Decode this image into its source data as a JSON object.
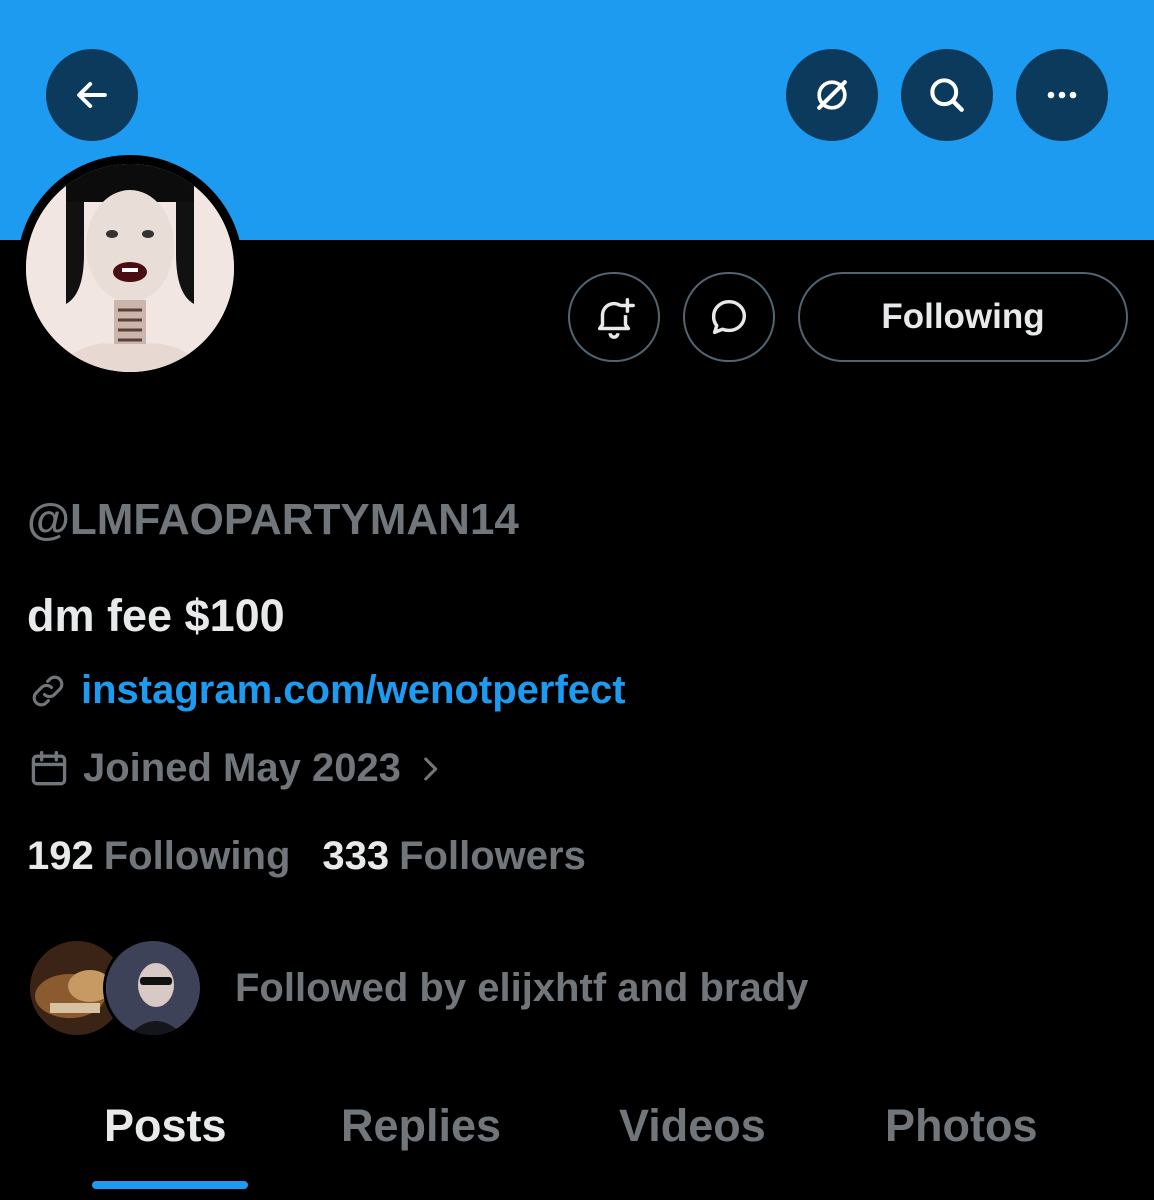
{
  "header": {
    "back_icon": "arrow-left-icon",
    "grok_icon": "grok-icon",
    "search_icon": "search-icon",
    "more_icon": "more-horizontal-icon"
  },
  "profile": {
    "handle": "@LMFAOPARTYMAN14",
    "bio": "dm fee $100",
    "link": "instagram.com/wenotperfect",
    "joined": "Joined May 2023",
    "following_count": "192",
    "following_label": "Following",
    "followers_count": "333",
    "followers_label": "Followers",
    "followed_by": "Followed by elijxhtf and brady"
  },
  "actions": {
    "notify_icon": "bell-plus-icon",
    "message_icon": "message-bubble-icon",
    "follow_button_label": "Following"
  },
  "tabs": [
    {
      "label": "Posts",
      "active": true
    },
    {
      "label": "Replies",
      "active": false
    },
    {
      "label": "Videos",
      "active": false
    },
    {
      "label": "Photos",
      "active": false
    }
  ],
  "colors": {
    "accent": "#1d9bf0",
    "background": "#000000",
    "muted": "#71767b",
    "text": "#e7e9ea"
  }
}
